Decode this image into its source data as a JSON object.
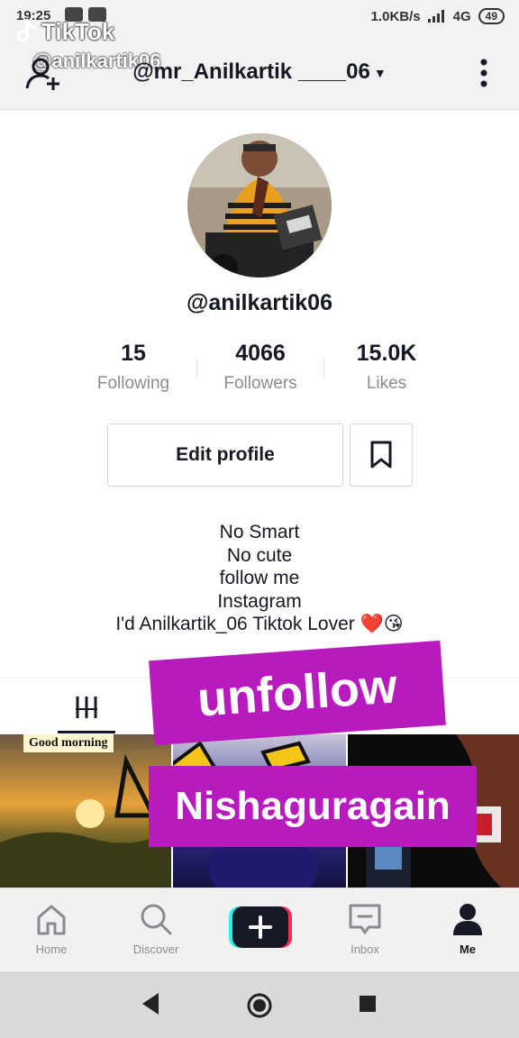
{
  "status_bar": {
    "time": "19:25",
    "network_speed": "1.0KB/s",
    "network_type": "4G",
    "battery": "49"
  },
  "watermark": {
    "app_name": "TikTok",
    "user": "@anilkartik06"
  },
  "header": {
    "title": "@mr_Anilkartik ____06"
  },
  "profile": {
    "username": "@anilkartik06",
    "stats": [
      {
        "value": "15",
        "label": "Following"
      },
      {
        "value": "4066",
        "label": "Followers"
      },
      {
        "value": "15.0K",
        "label": "Likes"
      }
    ],
    "edit_profile_label": "Edit profile",
    "bio_lines": [
      "No Smart",
      "No cute",
      "follow me",
      "Instagram",
      "I'd Anilkartik_06 Tiktok Lover ❤️😘"
    ]
  },
  "videos": {
    "thumb1_caption": "Good morning"
  },
  "stickers": {
    "top": "unfollow",
    "bottom": "Nishaguragain"
  },
  "bottom_nav": {
    "items": [
      {
        "label": "Home",
        "icon": "home-icon"
      },
      {
        "label": "Discover",
        "icon": "search-icon"
      },
      {
        "label": "",
        "icon": "plus-icon"
      },
      {
        "label": "Inbox",
        "icon": "inbox-icon"
      },
      {
        "label": "Me",
        "icon": "person-icon",
        "active": true
      }
    ]
  },
  "colors": {
    "sticker": "#b81bbd",
    "text_primary": "#161823",
    "text_secondary": "#8a8b91"
  }
}
